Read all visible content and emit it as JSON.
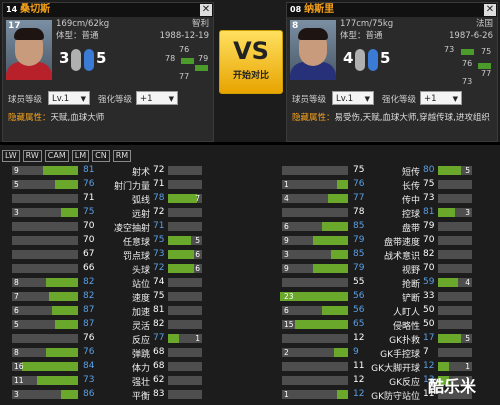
{
  "left_player": {
    "number": "14",
    "name": "桑切斯",
    "level": "17",
    "height_weight": "169cm/62kg",
    "nation": "智利",
    "body_type": "体型：普通",
    "birth": "1988-12-19",
    "left_foot": "3",
    "right_foot": "5",
    "pos_values": [
      "76",
      "78",
      "79",
      "77"
    ],
    "level_label": "球员等级",
    "level_select": "Lv.1",
    "enhance_label": "强化等级",
    "enhance_select": "+1",
    "hidden_attr_label": "隐藏属性：",
    "hidden_attr_value": "天赋,血球大师"
  },
  "right_player": {
    "number": "08",
    "name": "纳斯里",
    "level": "8",
    "height_weight": "177cm/75kg",
    "nation": "法国",
    "body_type": "体型：普通",
    "birth": "1987-6-26",
    "left_foot": "4",
    "right_foot": "5",
    "pos_values": [
      "73",
      "75",
      "76",
      "77",
      "73"
    ],
    "level_label": "球员等级",
    "level_select": "Lv.1",
    "enhance_label": "强化等级",
    "enhance_select": "+1",
    "hidden_attr_label": "隐藏属性：",
    "hidden_attr_value": "易受伤,天赋,血球大师,穿越传球,进攻组织"
  },
  "vs": {
    "big": "VS",
    "small": "开始对比"
  },
  "close_label": "✕",
  "position_tabs": [
    "LW",
    "RW",
    "CAM",
    "LM",
    "CN",
    "RM"
  ],
  "colors": {
    "accent": "#f7a31c",
    "better": "#6aa82c",
    "blue_value": "#5aa0e6",
    "neutral_value": "#ffffff"
  },
  "stats_left": [
    {
      "name": "射术",
      "a": "81",
      "b": "72",
      "diff": "9",
      "winner": "a"
    },
    {
      "name": "射门力量",
      "a": "76",
      "b": "71",
      "diff": "5",
      "winner": "a"
    },
    {
      "name": "弧线",
      "a": "71",
      "b": "78",
      "diff": "7",
      "winner": "b"
    },
    {
      "name": "远射",
      "a": "75",
      "b": "72",
      "diff": "3",
      "winner": "a"
    },
    {
      "name": "凌空抽射",
      "a": "70",
      "b": "71",
      "diff": "",
      "winner": "b"
    },
    {
      "name": "任意球",
      "a": "70",
      "b": "75",
      "diff": "5",
      "winner": "b"
    },
    {
      "name": "罚点球",
      "a": "67",
      "b": "73",
      "diff": "6",
      "winner": "b"
    },
    {
      "name": "头球",
      "a": "66",
      "b": "72",
      "diff": "6",
      "winner": "b"
    },
    {
      "name": "站位",
      "a": "82",
      "b": "74",
      "diff": "8",
      "winner": "a"
    },
    {
      "name": "速度",
      "a": "82",
      "b": "75",
      "diff": "7",
      "winner": "a"
    },
    {
      "name": "加速",
      "a": "87",
      "b": "81",
      "diff": "6",
      "winner": "a"
    },
    {
      "name": "灵活",
      "a": "87",
      "b": "82",
      "diff": "5",
      "winner": "a"
    },
    {
      "name": "反应",
      "a": "76",
      "b": "77",
      "diff": "1",
      "winner": "b"
    },
    {
      "name": "弹跳",
      "a": "76",
      "b": "68",
      "diff": "8",
      "winner": "a"
    },
    {
      "name": "体力",
      "a": "84",
      "b": "68",
      "diff": "16",
      "winner": "a"
    },
    {
      "name": "强壮",
      "a": "73",
      "b": "62",
      "diff": "11",
      "winner": "a"
    },
    {
      "name": "平衡",
      "a": "86",
      "b": "83",
      "diff": "3",
      "winner": "a"
    }
  ],
  "stats_right": [
    {
      "name": "短传",
      "a": "75",
      "b": "80",
      "diff": "5",
      "winner": "b"
    },
    {
      "name": "长传",
      "a": "76",
      "b": "75",
      "diff": "1",
      "winner": "a"
    },
    {
      "name": "传中",
      "a": "77",
      "b": "73",
      "diff": "4",
      "winner": "a"
    },
    {
      "name": "控球",
      "a": "78",
      "b": "81",
      "diff": "3",
      "winner": "b"
    },
    {
      "name": "盘带",
      "a": "85",
      "b": "79",
      "diff": "6",
      "winner": "a"
    },
    {
      "name": "盘带速度",
      "a": "79",
      "b": "70",
      "diff": "9",
      "winner": "a"
    },
    {
      "name": "战术意识",
      "a": "85",
      "b": "82",
      "diff": "3",
      "winner": "a"
    },
    {
      "name": "视野",
      "a": "79",
      "b": "70",
      "diff": "9",
      "winner": "a"
    },
    {
      "name": "抢断",
      "a": "55",
      "b": "59",
      "diff": "4",
      "winner": "b"
    },
    {
      "name": "铲断",
      "a": "56",
      "b": "33",
      "diff": "23",
      "winner": "a"
    },
    {
      "name": "人盯人",
      "a": "56",
      "b": "50",
      "diff": "6",
      "winner": "a"
    },
    {
      "name": "侵略性",
      "a": "65",
      "b": "50",
      "diff": "15",
      "winner": "a"
    },
    {
      "name": "GK扑救",
      "a": "12",
      "b": "17",
      "diff": "5",
      "winner": "b"
    },
    {
      "name": "GK手控球",
      "a": "9",
      "b": "7",
      "diff": "2",
      "winner": "a"
    },
    {
      "name": "GK大脚开球",
      "a": "11",
      "b": "12",
      "diff": "1",
      "winner": "b"
    },
    {
      "name": "GK反应",
      "a": "12",
      "b": "13",
      "diff": "1",
      "winner": "b"
    },
    {
      "name": "GK防守站位",
      "a": "12",
      "b": "11",
      "diff": "1",
      "winner": "a"
    }
  ],
  "watermark": "酷乐米"
}
